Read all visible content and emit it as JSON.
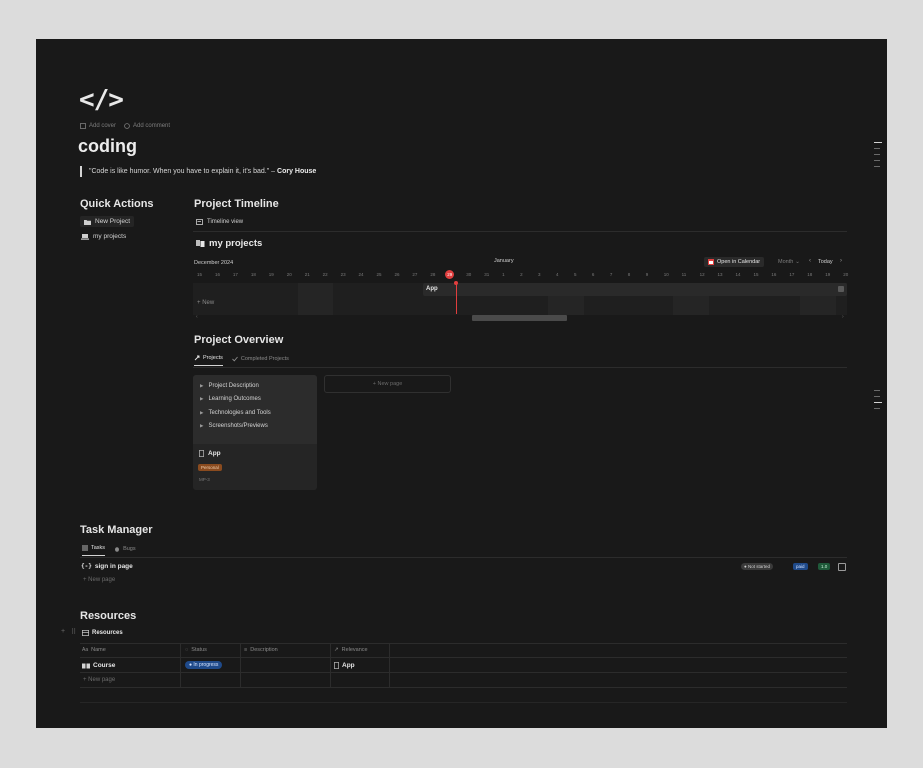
{
  "page": {
    "icon_text": "</>",
    "add_cover": "Add cover",
    "add_comment": "Add comment",
    "title": "coding",
    "quote_text": "\"Code is like humor. When you have to explain it, it's bad.\" – ",
    "quote_author": "Cory House"
  },
  "quick_actions": {
    "title": "Quick Actions",
    "new_project": "New Project",
    "my_projects": "my projects"
  },
  "timeline": {
    "title": "Project Timeline",
    "view_tab": "Timeline view",
    "db_title": "my projects",
    "month_left": "December 2024",
    "month_center": "January",
    "open_calendar": "Open in Calendar",
    "month_select": "Month",
    "today": "Today",
    "days": [
      "15",
      "16",
      "17",
      "18",
      "19",
      "20",
      "21",
      "22",
      "23",
      "24",
      "25",
      "26",
      "27",
      "28",
      "29",
      "30",
      "31",
      "1",
      "2",
      "3",
      "4",
      "5",
      "6",
      "7",
      "8",
      "9",
      "10",
      "11",
      "12",
      "13",
      "14",
      "15",
      "16",
      "17",
      "18",
      "19",
      "20"
    ],
    "today_day": "29",
    "bar_label": "App",
    "new_label": "New"
  },
  "overview": {
    "title": "Project Overview",
    "tab_projects": "Projects",
    "tab_completed": "Completed Projects",
    "toggles": [
      "Project Description",
      "Learning Outcomes",
      "Technologies and Tools",
      "Screenshots/Previews"
    ],
    "card_title": "App",
    "card_tag": "Personal",
    "card_id": "MP-3",
    "new_page": "New page"
  },
  "tasks": {
    "title": "Task Manager",
    "tab_tasks": "Tasks",
    "tab_bugs": "Bugs",
    "row_title": "sign in page",
    "row_status": "Not started",
    "row_tag": "paid",
    "row_num": "1.0",
    "new_page": "New page"
  },
  "resources": {
    "title": "Resources",
    "db_title": "Resources",
    "columns": [
      "Name",
      "Status",
      "Description",
      "Relevance"
    ],
    "row_name": "Course",
    "row_status": "In progress",
    "row_relevance": "App",
    "new_page": "New page"
  },
  "colors": {
    "background": "#191919",
    "accent_red": "#e03e3e",
    "tag_orange": "#8a4b1f",
    "tag_blue": "#1f4a8a",
    "tag_green": "#1f5a3a"
  }
}
